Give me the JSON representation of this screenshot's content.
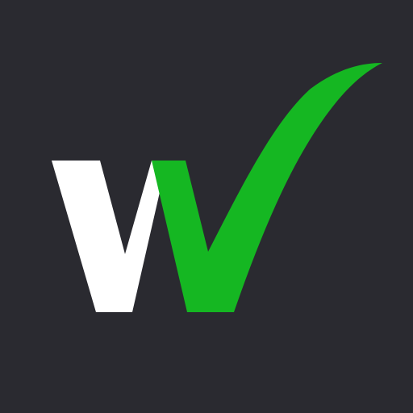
{
  "icon": {
    "name": "check-w-logo-icon",
    "colors": {
      "background": "#2a2a30",
      "left_stroke": "#ffffff",
      "check_stroke": "#15b722"
    }
  }
}
